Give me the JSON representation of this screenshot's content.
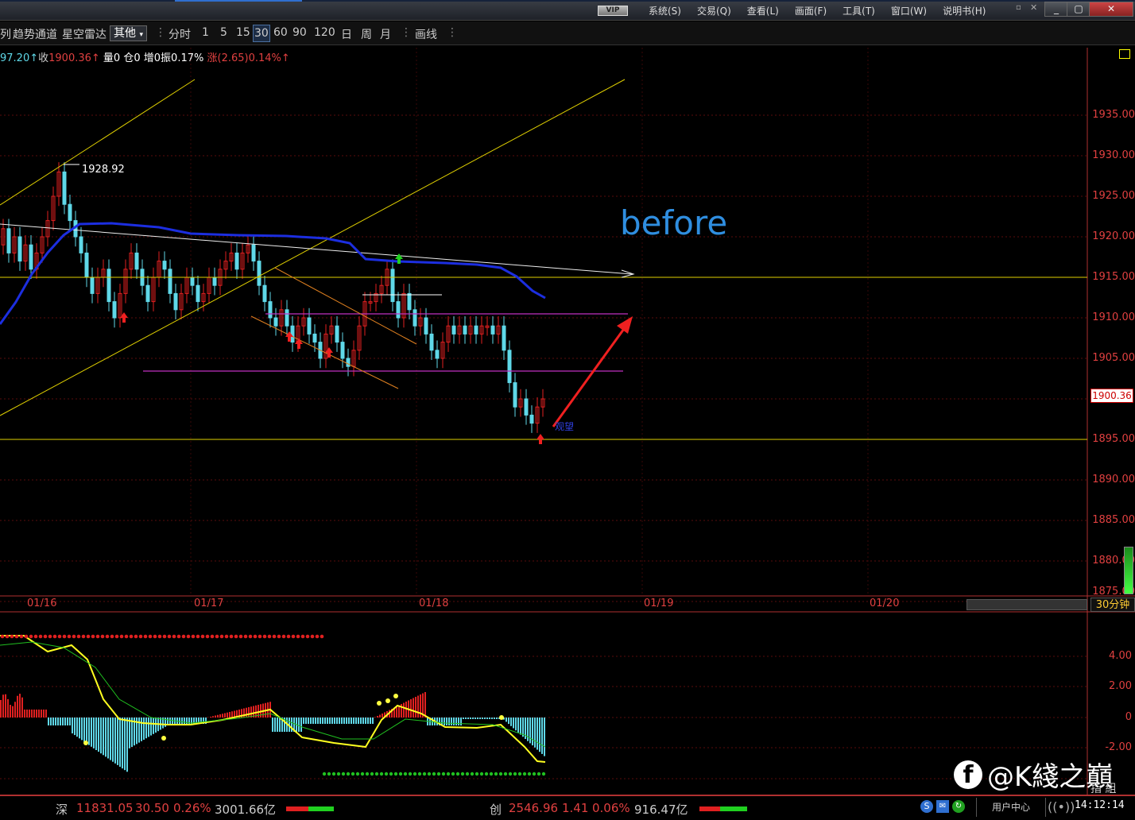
{
  "menubar": {
    "vip": "VIP",
    "items": [
      "系统(S)",
      "交易(Q)",
      "查看(L)",
      "画面(F)",
      "工具(T)",
      "窗口(W)",
      "说明书(H)"
    ],
    "controls": [
      "_",
      "▢",
      "✕"
    ]
  },
  "toolbar": {
    "items": [
      "列",
      "趋势通道",
      "星空雷达"
    ],
    "dropdown": "其他",
    "periods": [
      "分时",
      "1",
      "5",
      "15",
      "30",
      "60",
      "90",
      "120",
      "日",
      "周",
      "月"
    ],
    "selected_period": "30",
    "draw": "画线"
  },
  "quote": {
    "open": "97.20↑",
    "close_label": "收",
    "close": "1900.36↑",
    "volume": "量0",
    "position": "仓0",
    "increase": "增0",
    "amplitude": "振0.17%",
    "change_label": "涨",
    "change": "(2.65)0.14%↑"
  },
  "price_axis": [
    "1935.00",
    "1930.00",
    "1925.00",
    "1920.00",
    "1915.00",
    "1910.00",
    "1905.00",
    "1900.00",
    "1895.00",
    "1890.00",
    "1885.00",
    "1880.00",
    "1875.00"
  ],
  "current_price": "1900.36",
  "high_label": "1928.92",
  "annotation_before": "before",
  "annotation_small": "观望",
  "dates": [
    "01/16",
    "01/17",
    "01/18",
    "01/19",
    "01/20"
  ],
  "period_label": "30分钟",
  "indicator_axis": [
    "4.00",
    "2.00",
    "0",
    "-2.00"
  ],
  "indicator_button": "指 組",
  "status": {
    "sz_label": "深",
    "sz_index": "11831.05",
    "sz_change": "30.50",
    "sz_pct": "0.26%",
    "sz_amount": "3001.66亿",
    "cy_label": "创",
    "cy_index": "2546.96",
    "cy_change": "1.41",
    "cy_pct": "0.06%",
    "cy_amount": "916.47亿",
    "user_center": "用户中心",
    "time": "14:12:14"
  },
  "watermark": "@K綫之巔",
  "colors": {
    "up": "#e02020",
    "down": "#5fd8e8",
    "ma_blue": "#1c2ee0",
    "trend_yellow": "#e0d000",
    "support_magenta": "#c030c0",
    "channel_orange": "#e08020",
    "grid": "#6a1010"
  }
}
